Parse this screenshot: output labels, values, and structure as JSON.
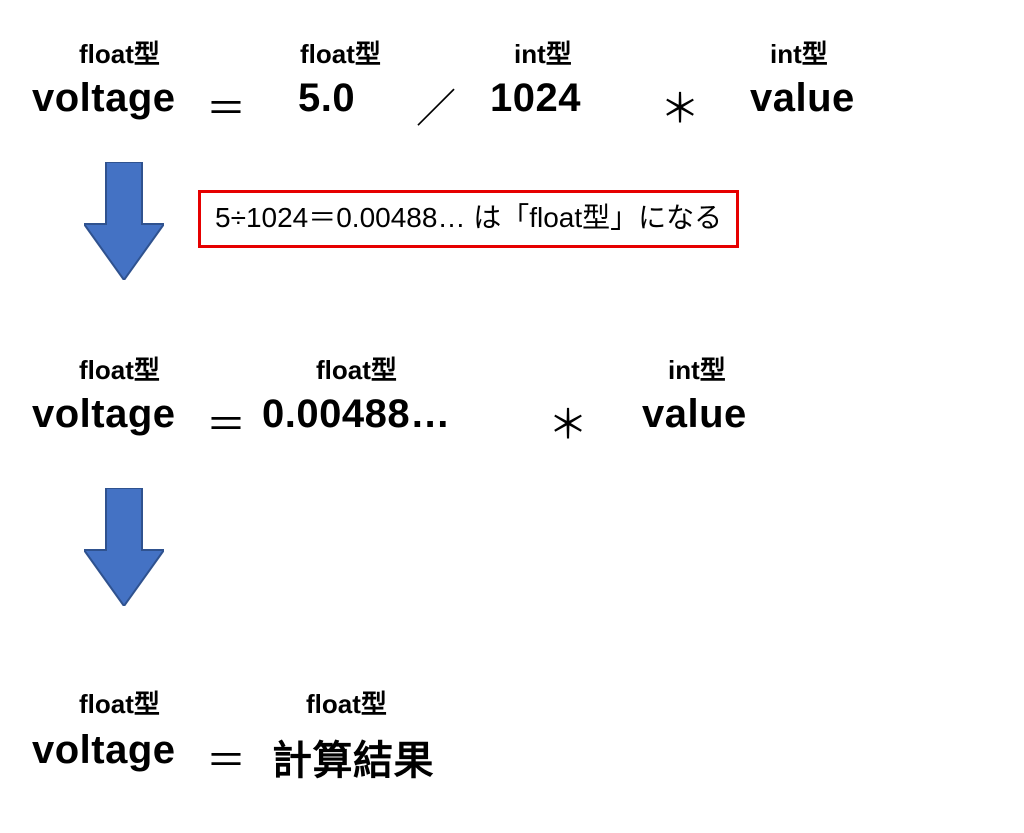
{
  "row1": {
    "labels": {
      "voltage": "float型",
      "five": "float型",
      "n1024": "int型",
      "value": "int型"
    },
    "expr": {
      "voltage": "voltage",
      "eq": "＝",
      "five": "5.0",
      "div": "／",
      "n1024": "1024",
      "mul": "＊",
      "value": "value"
    }
  },
  "callout": "5÷1024＝0.00488… は「float型」になる",
  "row2": {
    "labels": {
      "voltage": "float型",
      "result": "float型",
      "value": "int型"
    },
    "expr": {
      "voltage": "voltage",
      "eq": "＝",
      "result": "0.00488…",
      "mul": "＊",
      "value": "value"
    }
  },
  "row3": {
    "labels": {
      "voltage": "float型",
      "result": "float型"
    },
    "expr": {
      "voltage": "voltage",
      "eq": "＝",
      "result": "計算結果"
    }
  },
  "colors": {
    "arrow": "#4472c4",
    "callout_border": "#e60000"
  }
}
